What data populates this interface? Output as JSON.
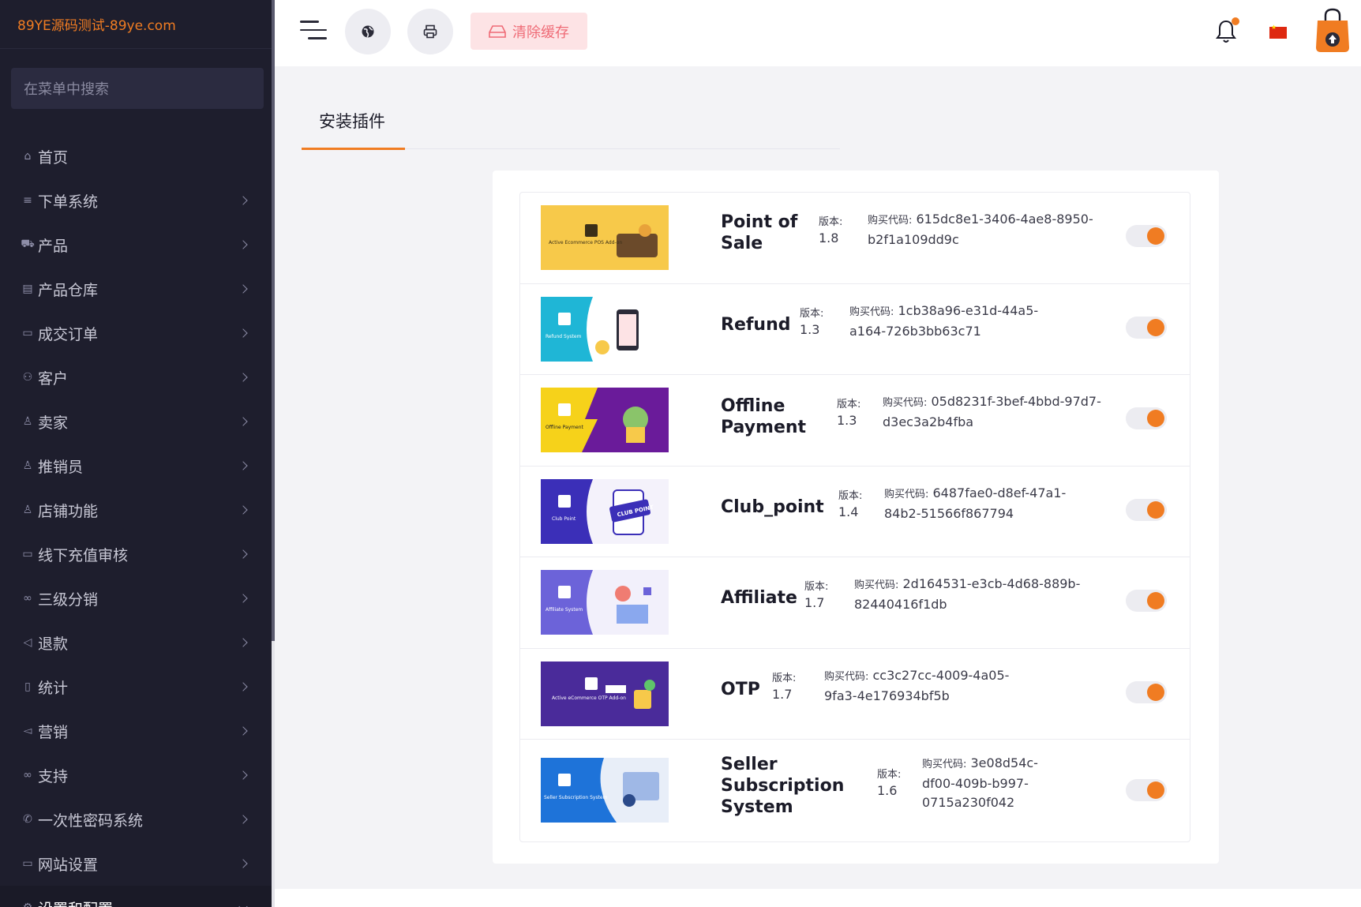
{
  "sidebar": {
    "brand": "89YE源码测试-89ye.com",
    "search_placeholder": "在菜单中搜索",
    "items": [
      {
        "label": "首页",
        "icon": "home-icon"
      },
      {
        "label": "下单系统",
        "icon": "list-icon"
      },
      {
        "label": "产品",
        "icon": "cart-icon"
      },
      {
        "label": "产品仓库",
        "icon": "archive-icon"
      },
      {
        "label": "成交订单",
        "icon": "money-icon"
      },
      {
        "label": "客户",
        "icon": "users-icon"
      },
      {
        "label": "卖家",
        "icon": "user-icon"
      },
      {
        "label": "推销员",
        "icon": "user-icon"
      },
      {
        "label": "店铺功能",
        "icon": "user-icon"
      },
      {
        "label": "线下充值审核",
        "icon": "money-icon"
      },
      {
        "label": "三级分销",
        "icon": "link-icon"
      },
      {
        "label": "退款",
        "icon": "backward-icon"
      },
      {
        "label": "统计",
        "icon": "file-icon"
      },
      {
        "label": "营销",
        "icon": "megaphone-icon"
      },
      {
        "label": "支持",
        "icon": "link-icon"
      },
      {
        "label": "一次性密码系统",
        "icon": "phone-icon"
      },
      {
        "label": "网站设置",
        "icon": "monitor-icon"
      },
      {
        "label": "设置和配置",
        "icon": "gear-icon"
      }
    ]
  },
  "header": {
    "clear_cache_label": "清除缓存"
  },
  "page": {
    "tab_title": "安装插件"
  },
  "plugins": [
    {
      "name": "Point of Sale",
      "version_label": "版本:",
      "version": "1.8",
      "code_label": "购买代码:",
      "code": "615dc8e1-3406-4ae8-8950-b2f1a109dd9c",
      "thumb_text": "Active Ecommerce POS Add-on",
      "enabled": true
    },
    {
      "name": "Refund",
      "version_label": "版本:",
      "version": "1.3",
      "code_label": "购买代码:",
      "code": "1cb38a96-e31d-44a5-a164-726b3bb63c71",
      "thumb_text": "Refund System",
      "enabled": true
    },
    {
      "name": "Offline Payment",
      "version_label": "版本:",
      "version": "1.3",
      "code_label": "购买代码:",
      "code": "05d8231f-3bef-4bbd-97d7-d3ec3a2b4fba",
      "thumb_text": "Offline Payment",
      "enabled": true
    },
    {
      "name": "Club_point",
      "version_label": "版本:",
      "version": "1.4",
      "code_label": "购买代码:",
      "code": "6487fae0-d8ef-47a1-84b2-51566f867794",
      "thumb_text": "Club Point",
      "enabled": true
    },
    {
      "name": "Affiliate",
      "version_label": "版本:",
      "version": "1.7",
      "code_label": "购买代码:",
      "code": "2d164531-e3cb-4d68-889b-82440416f1db",
      "thumb_text": "Affiliate System",
      "enabled": true
    },
    {
      "name": "OTP",
      "version_label": "版本:",
      "version": "1.7",
      "code_label": "购买代码:",
      "code": "cc3c27cc-4009-4a05-9fa3-4e176934bf5b",
      "thumb_text": "Active eCommerce OTP Add-on",
      "enabled": true
    },
    {
      "name": "Seller Subscription System",
      "version_label": "版本:",
      "version": "1.6",
      "code_label": "购买代码:",
      "code": "3e08d54c-df00-409b-b997-0715a230f042",
      "thumb_text": "Seller Subscription System",
      "enabled": true
    }
  ]
}
